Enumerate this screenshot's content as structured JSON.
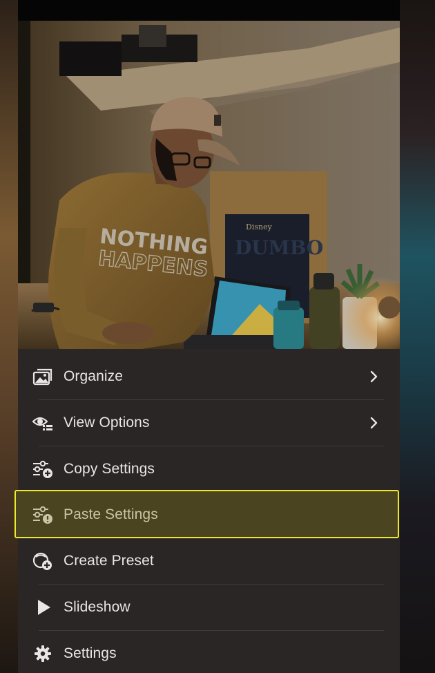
{
  "menu": {
    "items": [
      {
        "label": "Organize",
        "icon": "photo-stack-icon",
        "has_submenu": true
      },
      {
        "label": "View Options",
        "icon": "eye-list-icon",
        "has_submenu": true
      },
      {
        "label": "Copy Settings",
        "icon": "sliders-plus-icon",
        "has_submenu": false
      },
      {
        "label": "Paste Settings",
        "icon": "sliders-paste-icon",
        "has_submenu": false,
        "highlighted": true
      },
      {
        "label": "Create Preset",
        "icon": "preset-plus-icon",
        "has_submenu": false
      },
      {
        "label": "Slideshow",
        "icon": "play-icon",
        "has_submenu": false
      },
      {
        "label": "Settings",
        "icon": "gear-icon",
        "has_submenu": false
      }
    ]
  },
  "photo": {
    "sweatshirt_text_line1": "NOTHING",
    "sweatshirt_text_line2": "HAPPENS",
    "poster_brand": "Disney",
    "poster_title": "DUMBO"
  },
  "colors": {
    "menu_background": "#2a2626",
    "highlight_border": "#ecea2a",
    "highlight_fill": "#4a4420",
    "label_text": "#e9e6e3"
  }
}
